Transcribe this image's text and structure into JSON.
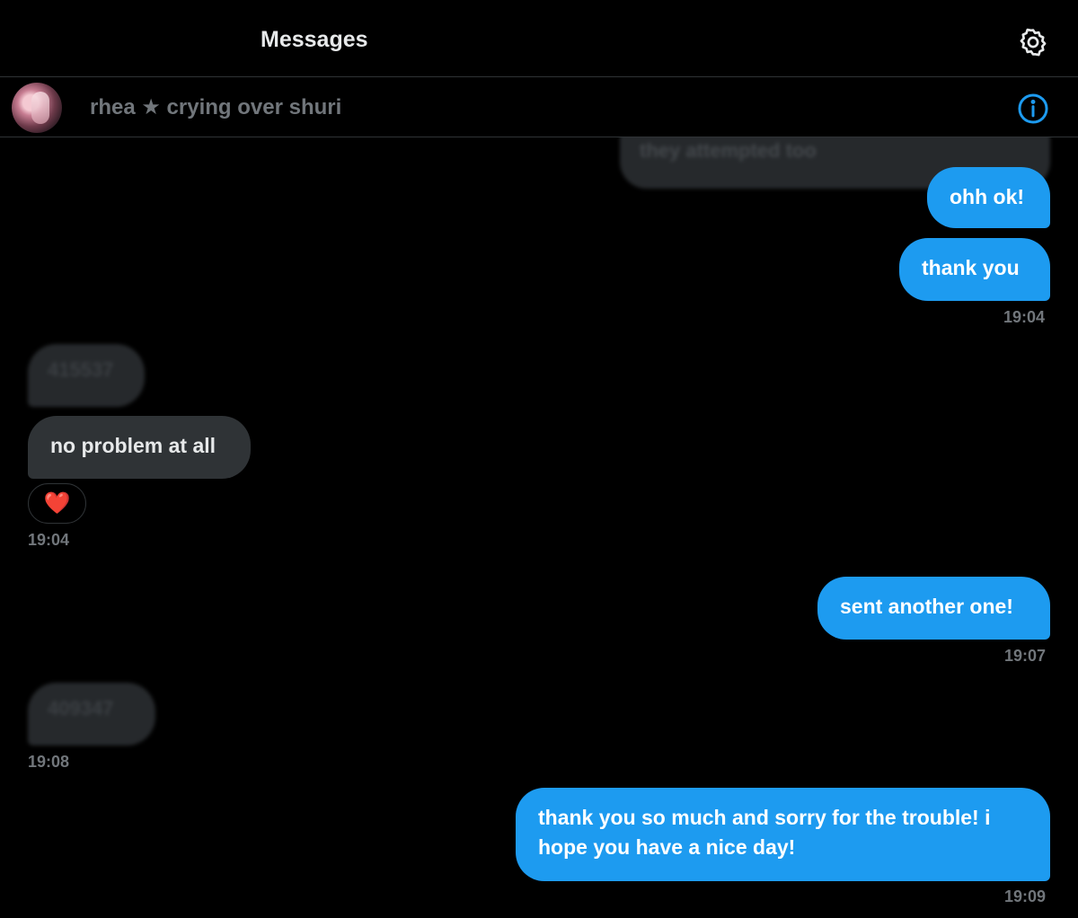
{
  "header": {
    "title": "Messages",
    "settings_icon": "gear-icon"
  },
  "conversation": {
    "name": "rhea ★ crying over shuri",
    "info_icon": "info-icon",
    "accent": "#1d9bf0"
  },
  "messages": [
    {
      "side": "sent",
      "text": "they attempted too",
      "blurred": true
    },
    {
      "side": "sent",
      "text": "ohh ok!"
    },
    {
      "side": "sent",
      "text": "thank you",
      "time": "19:04"
    },
    {
      "side": "received",
      "text": "415537",
      "blurred": true
    },
    {
      "side": "received",
      "text": "no problem at all",
      "reaction": "❤️",
      "time": "19:04"
    },
    {
      "side": "sent",
      "text": "sent another one!",
      "time": "19:07"
    },
    {
      "side": "received",
      "text": "409347",
      "blurred": true,
      "time": "19:08"
    },
    {
      "side": "sent",
      "text": "thank you so much and sorry for the trouble! i hope you have a nice day!",
      "time": "19:09"
    }
  ],
  "colors": {
    "background": "#000000",
    "sent_bubble": "#1d9bf0",
    "received_bubble": "#2f3336",
    "muted_text": "#71767b"
  }
}
